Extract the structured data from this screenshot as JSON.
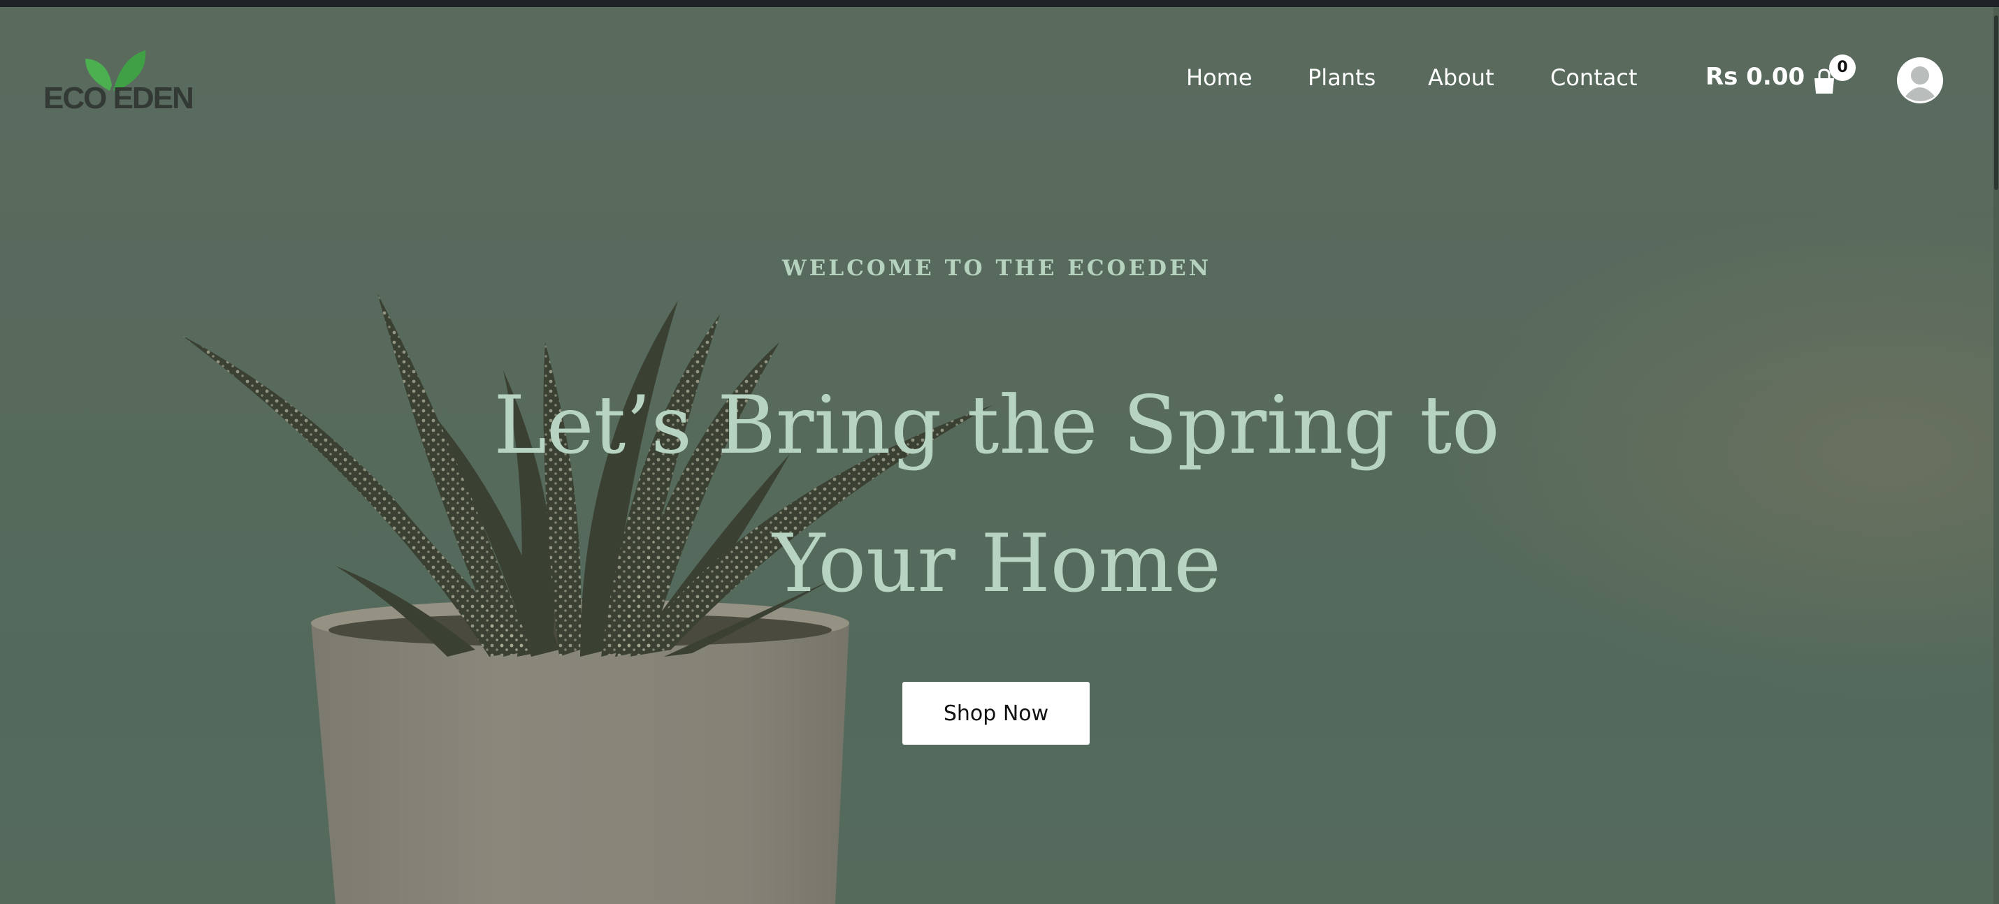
{
  "brand": {
    "name": "ECO EDEN",
    "logo_icon": "leaf-icon",
    "leaf_color": "#4caf50"
  },
  "nav": {
    "items": [
      {
        "label": "Home"
      },
      {
        "label": "Plants"
      },
      {
        "label": "About"
      },
      {
        "label": "Contact"
      }
    ]
  },
  "cart": {
    "total": "Rs 0.00",
    "count": "0",
    "icon": "shopping-bag-icon"
  },
  "user": {
    "icon": "user-avatar-icon"
  },
  "hero": {
    "eyebrow": "WELCOME TO THE ECOEDEN",
    "headline_line1": "Let’s Bring the Spring to",
    "headline_line2": "Your Home",
    "cta_label": "Shop Now",
    "accent_color": "#b7d4c3"
  }
}
